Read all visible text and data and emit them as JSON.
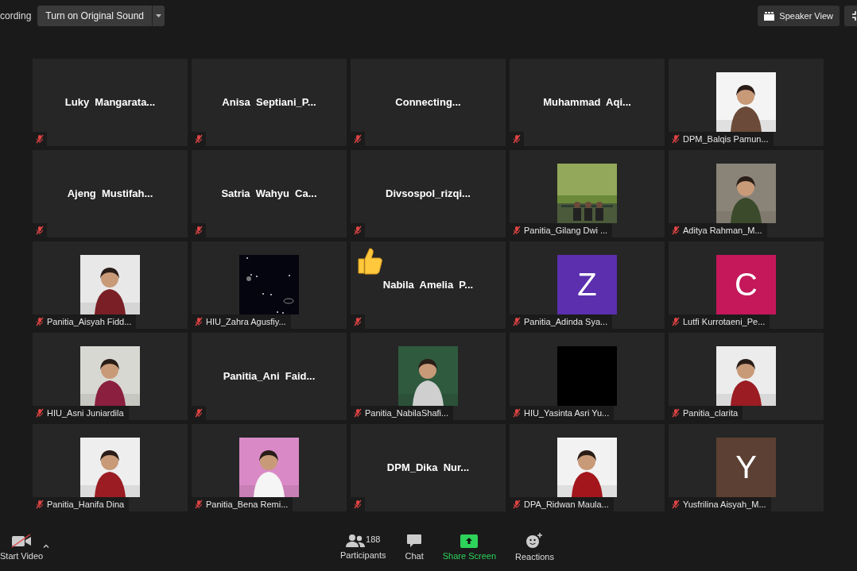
{
  "top_bar": {
    "recording_label": "cording",
    "original_sound_button": "Turn on Original Sound",
    "view_button": "Speaker View"
  },
  "tiles": [
    {
      "kind": "name",
      "name": "Luky  Mangarata...",
      "muted": true,
      "reaction": false
    },
    {
      "kind": "name",
      "name": "Anisa  Septiani_P...",
      "muted": true,
      "reaction": false
    },
    {
      "kind": "name",
      "name": "Connecting...",
      "muted": true,
      "reaction": false
    },
    {
      "kind": "name",
      "name": "Muhammad  Aqi...",
      "muted": true,
      "reaction": false
    },
    {
      "kind": "picture",
      "name": "DPM_Balqis Pamun...",
      "muted": true,
      "reaction": false
    },
    {
      "kind": "name",
      "name": "Ajeng  Mustifah...",
      "muted": true,
      "reaction": false
    },
    {
      "kind": "name",
      "name": "Satria  Wahyu  Ca...",
      "muted": true,
      "reaction": false
    },
    {
      "kind": "name",
      "name": "Divsospol_rizqi...",
      "muted": true,
      "reaction": false
    },
    {
      "kind": "picture",
      "name": "Panitia_Gilang Dwi ...",
      "muted": true,
      "reaction": false
    },
    {
      "kind": "picture",
      "name": "Aditya Rahman_M...",
      "muted": true,
      "reaction": false
    },
    {
      "kind": "picture",
      "name": "Panitia_Aisyah Fidd...",
      "muted": true,
      "reaction": false
    },
    {
      "kind": "picture",
      "name": "HIU_Zahra Agusfiy...",
      "muted": true,
      "reaction": false
    },
    {
      "kind": "name",
      "name": "Nabila  Amelia  P...",
      "muted": true,
      "reaction": true
    },
    {
      "kind": "letter",
      "letter": "Z",
      "color": "#5b2fae",
      "name": "Panitia_Adinda Sya...",
      "muted": true,
      "reaction": false
    },
    {
      "kind": "letter",
      "letter": "C",
      "color": "#c4185a",
      "name": "Lutfi Kurrotaeni_Pe...",
      "muted": true,
      "reaction": false
    },
    {
      "kind": "picture",
      "name": "HIU_Asni Juniardila",
      "muted": true,
      "reaction": false
    },
    {
      "kind": "name",
      "name": "Panitia_Ani  Faid...",
      "muted": true,
      "reaction": false
    },
    {
      "kind": "picture",
      "name": "Panitia_NabilaShafi...",
      "muted": true,
      "reaction": false
    },
    {
      "kind": "blank",
      "name": "HIU_Yasinta Asri Yu...",
      "muted": true,
      "reaction": false
    },
    {
      "kind": "picture",
      "name": "Panitia_clarita",
      "muted": true,
      "reaction": false
    },
    {
      "kind": "picture",
      "name": "Panitia_Hanifa Dina",
      "muted": true,
      "reaction": false
    },
    {
      "kind": "picture",
      "name": "Panitia_Bena Remi...",
      "muted": true,
      "reaction": false
    },
    {
      "kind": "name",
      "name": "DPM_Dika  Nur...",
      "muted": true,
      "reaction": false
    },
    {
      "kind": "picture",
      "name": "DPA_Ridwan Maula...",
      "muted": true,
      "reaction": false
    },
    {
      "kind": "letter",
      "letter": "Y",
      "color": "#5c4033",
      "name": "Yusfrilina Aisyah_M...",
      "muted": true,
      "reaction": false
    }
  ],
  "toolbar": {
    "video": {
      "label": "Start Video",
      "on": false
    },
    "participants": {
      "label": "Participants",
      "count": "188"
    },
    "chat": "Chat",
    "share": "Share Screen",
    "reactions": "Reactions"
  }
}
